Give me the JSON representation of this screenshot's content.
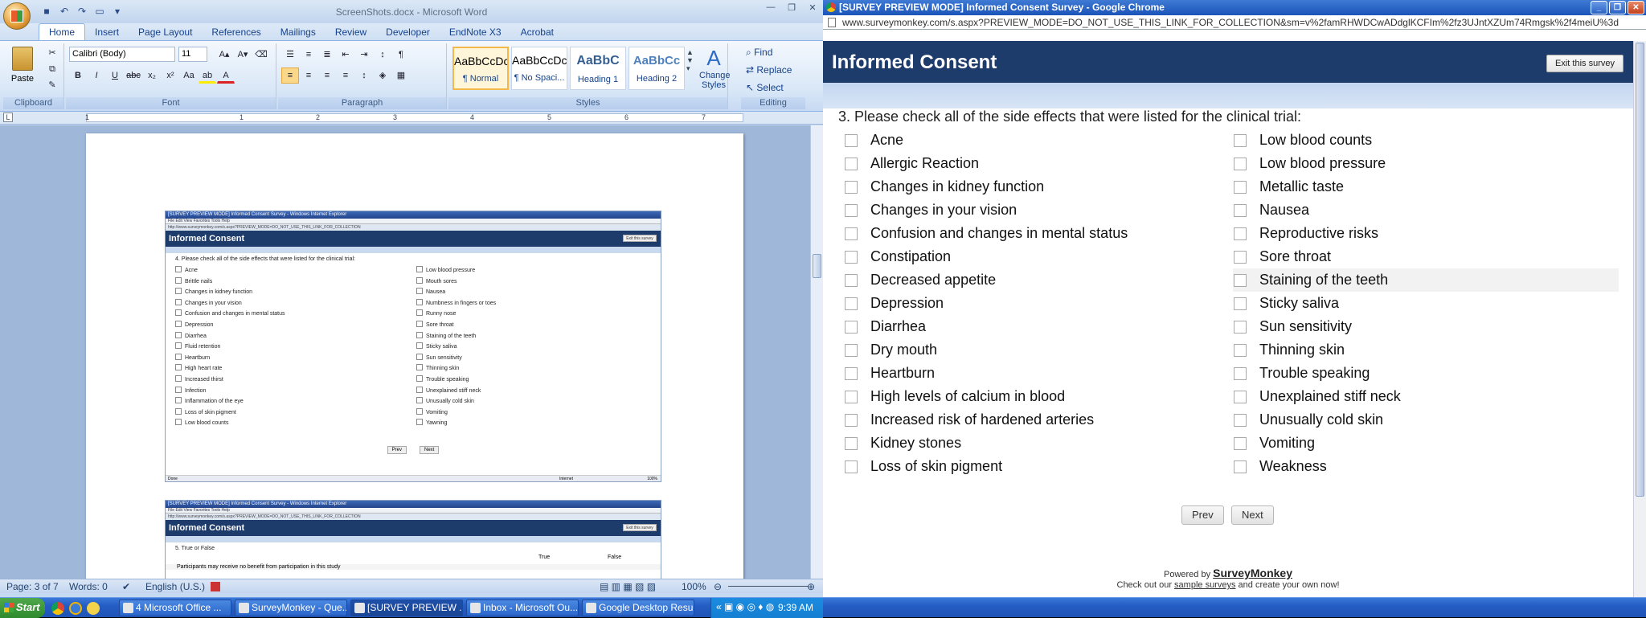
{
  "word": {
    "title": "ScreenShots.docx - Microsoft Word",
    "tabs": [
      "Home",
      "Insert",
      "Page Layout",
      "References",
      "Mailings",
      "Review",
      "Developer",
      "EndNote X3",
      "Acrobat"
    ],
    "font_name": "Calibri (Body)",
    "font_size": "11",
    "groups": [
      "Clipboard",
      "Font",
      "Paragraph",
      "Styles",
      "Editing"
    ],
    "paste_label": "Paste",
    "styles": [
      {
        "preview": "AaBbCcDc",
        "name": "¶ Normal"
      },
      {
        "preview": "AaBbCcDc",
        "name": "¶ No Spaci..."
      },
      {
        "preview": "AaBbC",
        "name": "Heading 1"
      },
      {
        "preview": "AaBbCc",
        "name": "Heading 2"
      }
    ],
    "change_styles": "Change Styles",
    "editing": {
      "find": "Find",
      "replace": "Replace",
      "select": "Select"
    },
    "ruler_numbers": [
      "1",
      "1",
      "2",
      "3",
      "4",
      "5",
      "6",
      "7"
    ],
    "status": {
      "page": "Page: 3 of 7",
      "words": "Words: 0",
      "language": "English (U.S.)",
      "zoom": "100%"
    }
  },
  "mini1": {
    "titlebar": "[SURVEY PREVIEW MODE] Informed Consent Survey - Windows Internet Explorer",
    "menu": "File   Edit   View   Favorites   Tools   Help",
    "address": "http://www.surveymonkey.com/s.aspx?PREVIEW_MODE=DO_NOT_USE_THIS_LINK_FOR_COLLECTION",
    "header": "Informed Consent",
    "exit": "Exit this survey",
    "question": "4. Please check all of the side effects that were listed for the clinical trial:",
    "left": [
      "Acne",
      "Brittle nails",
      "Changes in kidney function",
      "Changes in your vision",
      "Confusion and changes in mental status",
      "Depression",
      "Diarrhea",
      "Fluid retention",
      "Heartburn",
      "High heart rate",
      "Increased thirst",
      "Infection",
      "Inflammation of the eye",
      "Loss of skin pigment",
      "Low blood counts"
    ],
    "right": [
      "Low blood pressure",
      "Mouth sores",
      "Nausea",
      "Numbness in fingers or toes",
      "Runny nose",
      "Sore throat",
      "Staining of the teeth",
      "Sticky saliva",
      "Sun sensitivity",
      "Thinning skin",
      "Trouble speaking",
      "Unexplained stiff neck",
      "Unusually cold skin",
      "Vomiting",
      "Yawning"
    ],
    "prev": "Prev",
    "next": "Next",
    "status": "Done",
    "zone": "Internet",
    "zoom": "100%"
  },
  "mini2": {
    "titlebar": "[SURVEY PREVIEW MODE] Informed Consent Survey - Windows Internet Explorer",
    "menu": "File   Edit   View   Favorites   Tools   Help",
    "address": "http://www.surveymonkey.com/s.aspx?PREVIEW_MODE=DO_NOT_USE_THIS_LINK_FOR_COLLECTION",
    "header": "Informed Consent",
    "exit": "Exit this survey",
    "question": "5. True or False",
    "col_true": "True",
    "col_false": "False",
    "statement": "Participants may receive no benefit from participation in this study"
  },
  "chrome": {
    "title": "[SURVEY PREVIEW MODE] Informed Consent Survey - Google Chrome",
    "url": "www.surveymonkey.com/s.aspx?PREVIEW_MODE=DO_NOT_USE_THIS_LINK_FOR_COLLECTION&sm=v%2famRHWDCwADdglKCFIm%2fz3UJntXZUm74Rmgsk%2f4meiU%3d",
    "survey_title": "Informed Consent",
    "exit": "Exit this survey",
    "question": "3. Please check all of the side effects that were listed for the clinical trial:",
    "left": [
      "Acne",
      "Allergic Reaction",
      "Changes in kidney function",
      "Changes in your vision",
      "Confusion and changes in mental status",
      "Constipation",
      "Decreased appetite",
      "Depression",
      "Diarrhea",
      "Dry mouth",
      "Heartburn",
      "High levels of calcium in blood",
      "Increased risk of hardened arteries",
      "Kidney stones",
      "Loss of skin pigment"
    ],
    "right": [
      "Low blood counts",
      "Low blood pressure",
      "Metallic taste",
      "Nausea",
      "Reproductive risks",
      "Sore throat",
      "Staining of the teeth",
      "Sticky saliva",
      "Sun sensitivity",
      "Thinning skin",
      "Trouble speaking",
      "Unexplained stiff neck",
      "Unusually cold skin",
      "Vomiting",
      "Weakness"
    ],
    "highlighted": "Staining of the teeth",
    "prev": "Prev",
    "next": "Next",
    "powered_by": "Powered by",
    "brand": "SurveyMonkey",
    "checkout_pre": "Check out our",
    "checkout_link": "sample surveys",
    "checkout_post": "and create your own now!"
  },
  "taskbar": {
    "start": "Start",
    "tasks": [
      {
        "label": "4 Microsoft Office ...",
        "active": false
      },
      {
        "label": "SurveyMonkey - Que...",
        "active": false
      },
      {
        "label": "[SURVEY PREVIEW ...",
        "active": true
      },
      {
        "label": "Inbox - Microsoft Ou...",
        "active": false
      },
      {
        "label": "Google Desktop Results",
        "active": false
      }
    ],
    "clock": "9:39 AM"
  }
}
